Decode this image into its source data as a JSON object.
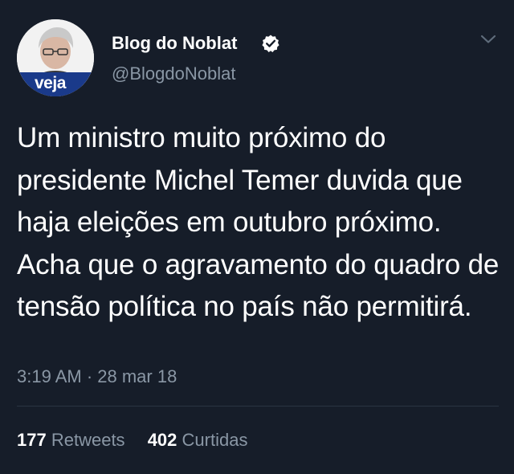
{
  "author": {
    "display_name": "Blog do Noblat",
    "handle": "@BlogdoNoblat",
    "avatar_badge": "veja",
    "verified_icon": "verified-badge-icon",
    "badge_color": "#1a3a8a"
  },
  "tweet": {
    "text": "Um ministro muito próximo do presidente Michel Temer duvida que haja eleições em outubro próximo. Acha que o agravamento do quadro de tensão política no país não permitirá.",
    "timestamp": "3:19 AM · 28 mar 18"
  },
  "stats": {
    "retweets_count": "177",
    "retweets_label": "Retweets",
    "likes_count": "402",
    "likes_label": "Curtidas"
  },
  "menu": {
    "icon": "chevron-down-icon"
  },
  "colors": {
    "background": "#161d29",
    "text_primary": "#ffffff",
    "text_secondary": "#8a97a5",
    "divider": "#2a3442"
  }
}
